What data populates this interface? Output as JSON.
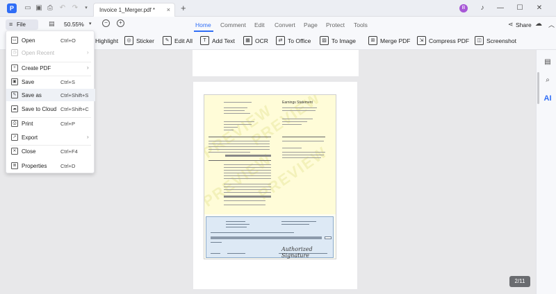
{
  "titlebar": {
    "app_logo": "P",
    "document_tab_title": "Invoice 1_Merger.pdf *",
    "tab_close": "×",
    "tab_add": "+",
    "avatar_initial": "B",
    "icons": [
      "sidebar-icon",
      "save-icon",
      "print-icon",
      "undo-icon",
      "redo-icon",
      "dropdown-icon",
      "bell-icon",
      "minimize-icon",
      "maximize-icon",
      "close-icon"
    ]
  },
  "menubar": {
    "file_label": "File",
    "zoom_value": "50.55%",
    "ribbon_tabs": [
      "Home",
      "Comment",
      "Edit",
      "Convert",
      "Page",
      "Protect",
      "Tools"
    ],
    "active_tab": "Home",
    "share_label": "Share"
  },
  "toolbar": {
    "tools": [
      "Highlight",
      "Sticker",
      "Edit All",
      "Add Text",
      "OCR",
      "To Office",
      "To Image",
      "Merge PDF",
      "Compress PDF",
      "Screenshot"
    ]
  },
  "file_menu": {
    "items": [
      {
        "label": "Open",
        "shortcut": "Ctrl+O"
      },
      {
        "label": "Open Recent",
        "shortcut": ""
      },
      {
        "label": "Create PDF",
        "shortcut": ""
      },
      {
        "label": "Save",
        "shortcut": "Ctrl+S"
      },
      {
        "label": "Save as",
        "shortcut": "Ctrl+Shift+S"
      },
      {
        "label": "Save to Cloud",
        "shortcut": "Ctrl+Shift+C"
      },
      {
        "label": "Print",
        "shortcut": "Ctrl+P"
      },
      {
        "label": "Export",
        "shortcut": ""
      },
      {
        "label": "Close",
        "shortcut": "Ctrl+F4"
      },
      {
        "label": "Properties",
        "shortcut": "Ctrl+D"
      }
    ]
  },
  "document": {
    "heading": "Earnings Statement",
    "watermark": "PREVIEW",
    "signature": "Authorized Signature"
  },
  "status": {
    "page_counter": "2/11"
  },
  "colors": {
    "accent": "#2f6df6",
    "page_bg": "#ffffff",
    "canvas_bg": "#e8e8ea",
    "doc_yellow": "#fffcd8",
    "stub_blue": "#dde9f5"
  }
}
